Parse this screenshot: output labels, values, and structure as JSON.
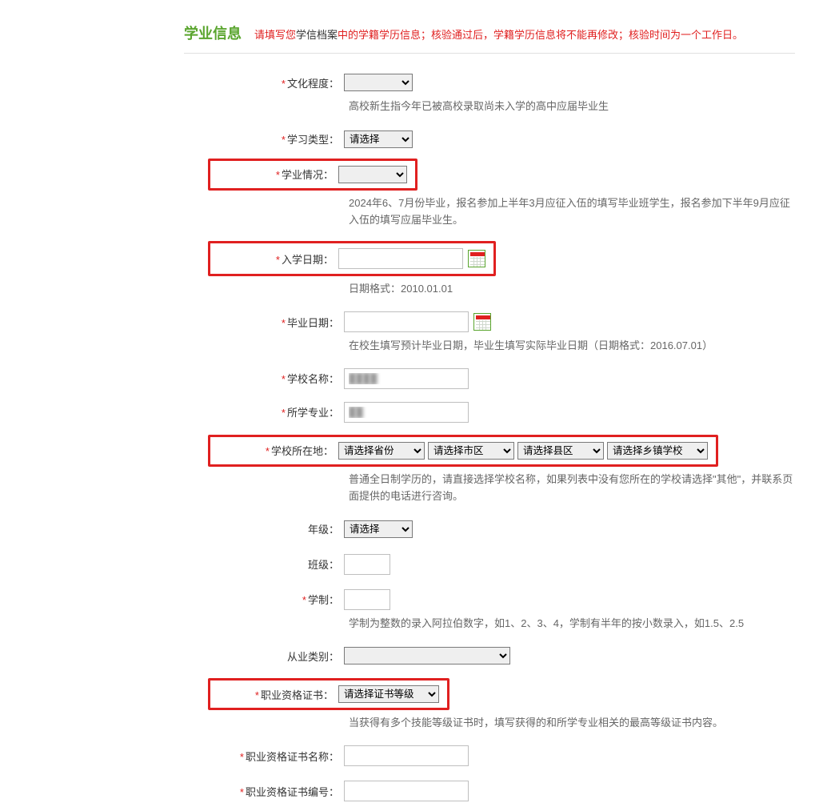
{
  "header": {
    "title": "学业信息",
    "note_prefix": "请填写您",
    "note_archive": "学信档案",
    "note_suffix": "中的学籍学历信息；核验通过后，学籍学历信息将不能再修改；核验时间为一个工作日。"
  },
  "fields": {
    "edu_level": {
      "label": "文化程度：",
      "value": "　",
      "help": "高校新生指今年已被高校录取尚未入学的高中应届毕业生"
    },
    "study_type": {
      "label": "学习类型：",
      "value": "请选择"
    },
    "study_status": {
      "label": "学业情况：",
      "value": "　",
      "help": "2024年6、7月份毕业，报名参加上半年3月应征入伍的填写毕业班学生，报名参加下半年9月应征入伍的填写应届毕业生。"
    },
    "enroll_date": {
      "label": "入学日期：",
      "value": "",
      "help": "日期格式：2010.01.01"
    },
    "grad_date": {
      "label": "毕业日期：",
      "value": "",
      "help": "在校生填写预计毕业日期，毕业生填写实际毕业日期（日期格式：2016.07.01）"
    },
    "school_name": {
      "label": "学校名称：",
      "value": ""
    },
    "major": {
      "label": "所学专业：",
      "value": ""
    },
    "school_loc": {
      "label": "学校所在地：",
      "province": "请选择省份",
      "city": "请选择市区",
      "county": "请选择县区",
      "town": "请选择乡镇学校",
      "help": "普通全日制学历的，请直接选择学校名称，如果列表中没有您所在的学校请选择\"其他\"，并联系页面提供的电话进行咨询。"
    },
    "grade": {
      "label": "年级：",
      "value": "请选择"
    },
    "class": {
      "label": "班级：",
      "value": ""
    },
    "length": {
      "label": "学制：",
      "value": "",
      "help": "学制为整数的录入阿拉伯数字，如1、2、3、4，学制有半年的按小数录入，如1.5、2.5"
    },
    "occ_type": {
      "label": "从业类别：",
      "value": "　"
    },
    "cert": {
      "label": "职业资格证书：",
      "value": "请选择证书等级",
      "help": "当获得有多个技能等级证书时，填写获得的和所学专业相关的最高等级证书内容。"
    },
    "cert_name": {
      "label": "职业资格证书名称：",
      "value": ""
    },
    "cert_no": {
      "label": "职业资格证书编号：",
      "value": ""
    }
  }
}
